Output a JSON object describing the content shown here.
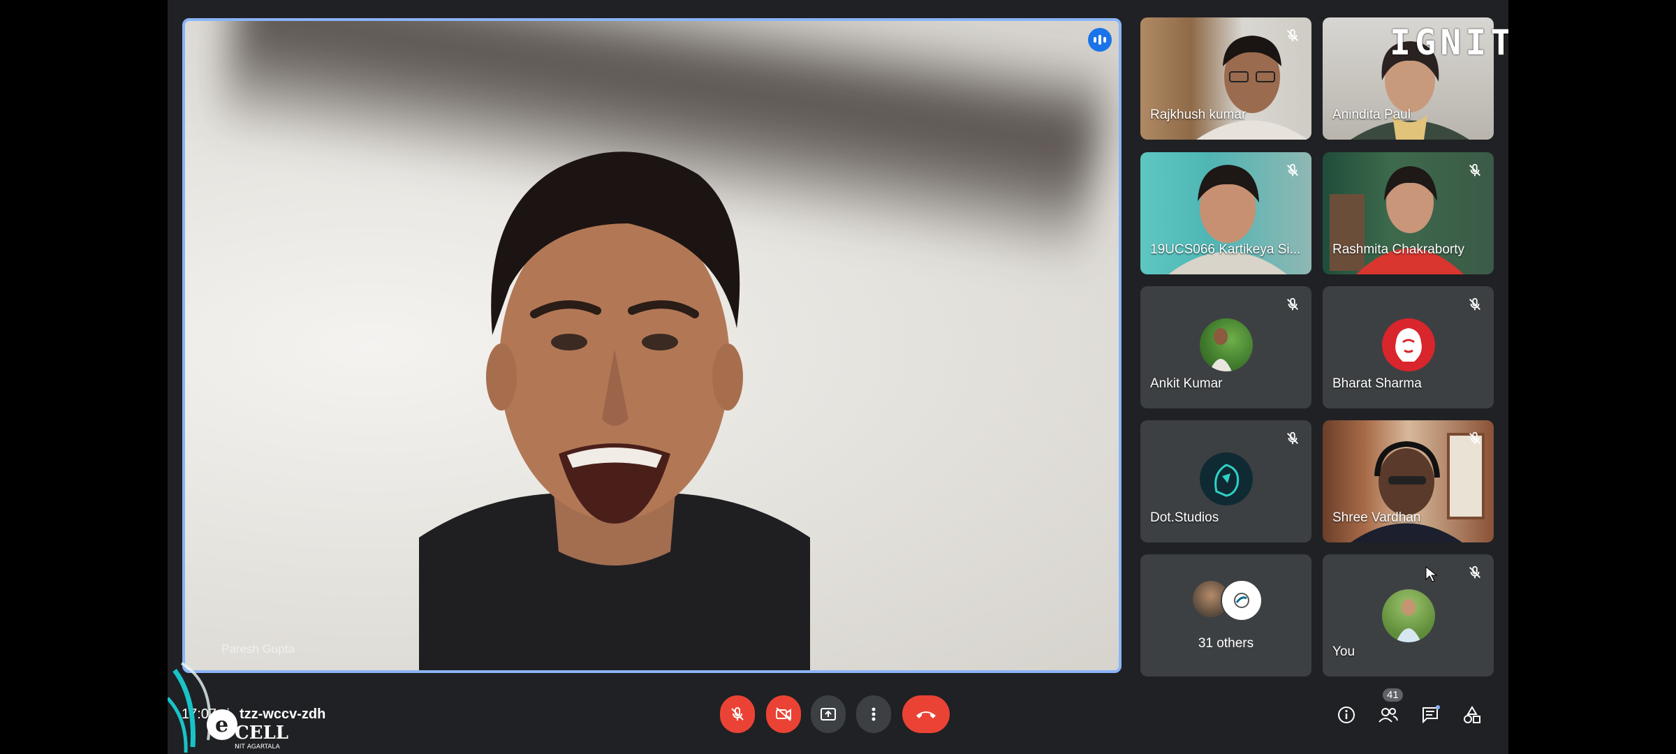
{
  "main_speaker": {
    "name": "Paresh Gupta"
  },
  "participants": [
    {
      "name": "Rajkhush kumar",
      "muted": true
    },
    {
      "name": "Anindita Paul",
      "muted": false
    },
    {
      "name": "19UCS066 Kartikeya Si...",
      "muted": true
    },
    {
      "name": "Rashmita Chakraborty",
      "muted": true
    },
    {
      "name": "Ankit Kumar",
      "muted": true
    },
    {
      "name": "Bharat Sharma",
      "muted": true
    },
    {
      "name": "Dot.Studios",
      "muted": true
    },
    {
      "name": "Shree Vardhan",
      "muted": true
    }
  ],
  "others": {
    "label": "31 others"
  },
  "self": {
    "label": "You",
    "muted": true
  },
  "meeting": {
    "time": "17:07",
    "separator": "|",
    "code": "tzz-wccv-zdh"
  },
  "controls": {
    "mic": "mic-off-icon",
    "camera": "camera-off-icon",
    "present": "present-screen-icon",
    "more": "more-options-icon",
    "end_call": "end-call-icon"
  },
  "side_panel": {
    "people_count": "41"
  },
  "branding": {
    "ignite_logo": "IGNITE",
    "ecell_logo": "E-CELL NIT AGARTALA"
  },
  "colors": {
    "accent": "#8ab4f8",
    "speaking": "#1a73e8",
    "danger": "#ea4335",
    "tile_bg": "#3c4043",
    "bar_bg": "#202124"
  }
}
